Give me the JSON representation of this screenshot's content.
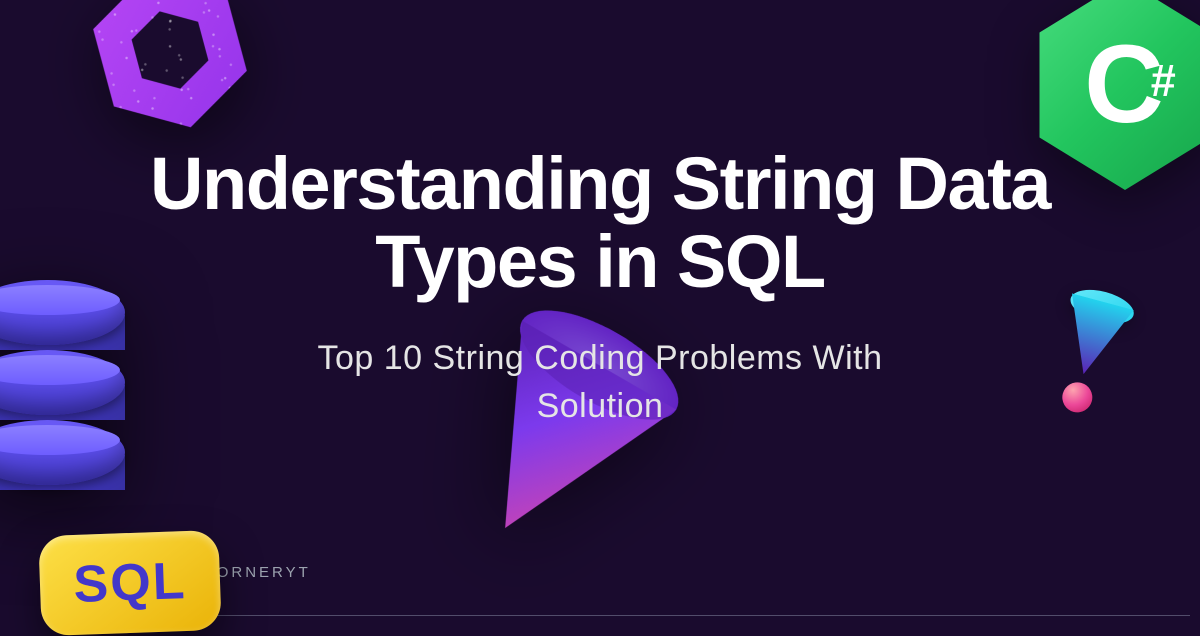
{
  "title": "Understanding String Data Types in SQL",
  "subtitle": "Top 10 String Coding Problems With Solution",
  "handle": "@DOTNETCORNERYT",
  "badges": {
    "sql_label": "SQL",
    "csharp_c": "C",
    "csharp_hash": "#"
  }
}
